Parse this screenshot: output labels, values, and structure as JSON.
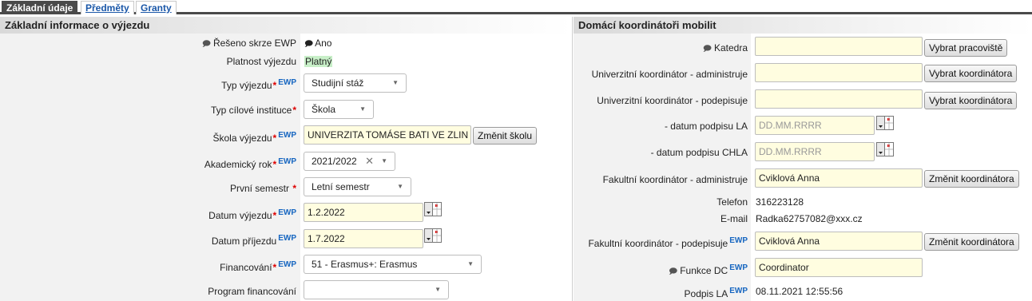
{
  "tabs": [
    {
      "label": "Základní údaje"
    },
    {
      "label": "Předměty"
    },
    {
      "label": "Granty"
    }
  ],
  "left": {
    "title": "Základní informace o výjezdu",
    "rows": {
      "ewp": {
        "label": "Řešeno skrze EWP",
        "value": "Ano"
      },
      "validity": {
        "label": "Platnost výjezdu",
        "value": "Platný"
      },
      "trip_type": {
        "label": "Typ výjezdu",
        "value": "Studijní stáž"
      },
      "institution_type": {
        "label": "Typ cílové instituce",
        "value": "Škola"
      },
      "school": {
        "label": "Škola výjezdu",
        "value": "UNIVERZITA TOMÁSE BATI VE ZLIN",
        "button": "Změnit školu"
      },
      "year": {
        "label": "Akademický rok",
        "value": "2021/2022"
      },
      "semester": {
        "label": "První semestr",
        "value": "Letní semestr"
      },
      "departure": {
        "label": "Datum výjezdu",
        "value": "1.2.2022"
      },
      "arrival": {
        "label": "Datum příjezdu",
        "value": "1.7.2022"
      },
      "financing": {
        "label": "Financování",
        "value": "51 - Erasmus+: Erasmus"
      },
      "program": {
        "label": "Program financování",
        "value": ""
      }
    },
    "ewp_tag": "EWP"
  },
  "right": {
    "title": "Domácí koordinátoři mobilit",
    "rows": {
      "department": {
        "label": "Katedra",
        "value": "",
        "button": "Vybrat pracoviště"
      },
      "univ_admin": {
        "label": "Univerzitní koordinátor - administruje",
        "value": "",
        "button": "Vybrat koordinátora"
      },
      "univ_sign": {
        "label": "Univerzitní koordinátor - podepisuje",
        "value": "",
        "button": "Vybrat koordinátora"
      },
      "la_date": {
        "label": "- datum podpisu LA",
        "placeholder": "DD.MM.RRRR"
      },
      "chla_date": {
        "label": "- datum podpisu CHLA",
        "placeholder": "DD.MM.RRRR"
      },
      "fac_admin": {
        "label": "Fakultní koordinátor - administruje",
        "value": "Cviklová Anna",
        "button": "Změnit koordinátora"
      },
      "phone": {
        "label": "Telefon",
        "value": "316223128"
      },
      "email": {
        "label": "E-mail",
        "value": "Radka62757082@xxx.cz"
      },
      "fac_sign": {
        "label": "Fakultní koordinátor - podepisuje",
        "value": "Cviklová Anna",
        "button": "Změnit koordinátora"
      },
      "dc_function": {
        "label": "Funkce DC",
        "value": "Coordinator"
      },
      "la_sign": {
        "label": "Podpis LA",
        "value": "08.11.2021 12:55:56"
      }
    }
  },
  "icons": {
    "comment": "comment-icon",
    "calendar": "calendar-icon",
    "required": "*"
  },
  "colors": {
    "tab_active": "#4a4a4a",
    "input_bg": "#fffde0",
    "ewp_blue": "#1565c0",
    "required_red": "#dd0000",
    "valid_green": "#c8efc8"
  }
}
